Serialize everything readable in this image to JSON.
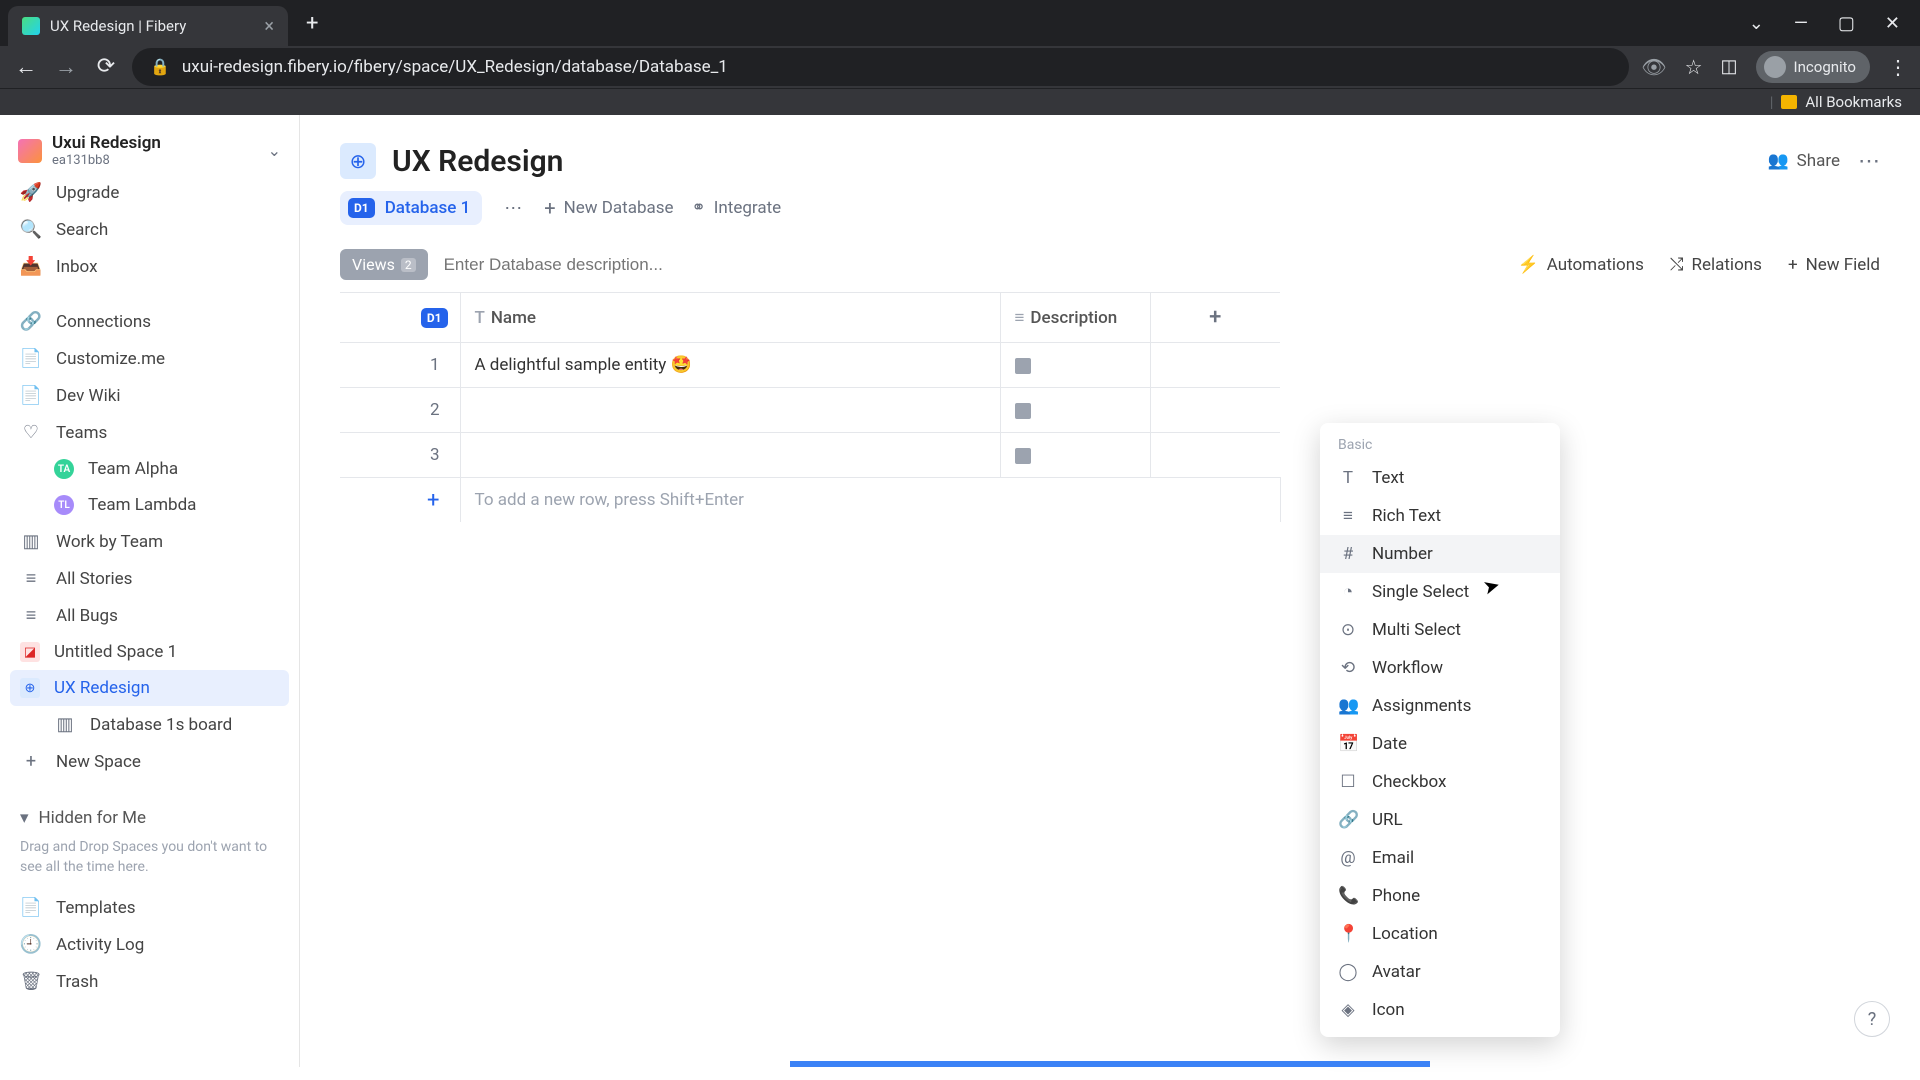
{
  "browser": {
    "tab_title": "UX Redesign | Fibery",
    "url": "uxui-redesign.fibery.io/fibery/space/UX_Redesign/database/Database_1",
    "incognito": "Incognito",
    "bookmarks": "All Bookmarks"
  },
  "workspace": {
    "name": "Uxui Redesign",
    "id": "ea131bb8"
  },
  "sidebar": {
    "upgrade": "Upgrade",
    "search": "Search",
    "inbox": "Inbox",
    "connections": "Connections",
    "customize": "Customize.me",
    "devwiki": "Dev Wiki",
    "teams": "Teams",
    "team_alpha": "Team Alpha",
    "team_lambda": "Team Lambda",
    "work_by_team": "Work by Team",
    "all_stories": "All Stories",
    "all_bugs": "All Bugs",
    "untitled_space": "Untitled Space 1",
    "ux_redesign": "UX Redesign",
    "db1_board": "Database 1s board",
    "new_space": "New Space",
    "hidden_label": "Hidden for Me",
    "hidden_hint": "Drag and Drop Spaces you don't want to see all the time here.",
    "templates": "Templates",
    "activity_log": "Activity Log",
    "trash": "Trash"
  },
  "page": {
    "title": "UX Redesign",
    "share": "Share",
    "db1": "Database 1",
    "new_database": "New Database",
    "integrate": "Integrate",
    "views": "Views",
    "views_count": "2",
    "desc_placeholder": "Enter Database description...",
    "automations": "Automations",
    "relations": "Relations",
    "new_field": "New Field"
  },
  "table": {
    "col_name": "Name",
    "col_desc": "Description",
    "rows": [
      {
        "num": "1",
        "name": "A delightful sample entity 🤩"
      },
      {
        "num": "2",
        "name": ""
      },
      {
        "num": "3",
        "name": ""
      }
    ],
    "add_row_hint": "To add a new row, press Shift+Enter"
  },
  "dropdown": {
    "heading": "Basic",
    "items": [
      {
        "icon": "T",
        "label": "Text"
      },
      {
        "icon": "≡",
        "label": "Rich Text"
      },
      {
        "icon": "#",
        "label": "Number",
        "hover": true
      },
      {
        "icon": "◔",
        "label": "Single Select"
      },
      {
        "icon": "⊙",
        "label": "Multi Select"
      },
      {
        "icon": "⟲",
        "label": "Workflow"
      },
      {
        "icon": "👥",
        "label": "Assignments"
      },
      {
        "icon": "📅",
        "label": "Date"
      },
      {
        "icon": "☐",
        "label": "Checkbox"
      },
      {
        "icon": "🔗",
        "label": "URL"
      },
      {
        "icon": "@",
        "label": "Email"
      },
      {
        "icon": "📞",
        "label": "Phone"
      },
      {
        "icon": "📍",
        "label": "Location"
      },
      {
        "icon": "◯",
        "label": "Avatar"
      },
      {
        "icon": "◈",
        "label": "Icon"
      }
    ]
  },
  "help": "?"
}
